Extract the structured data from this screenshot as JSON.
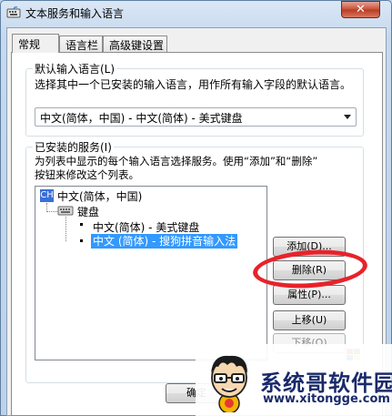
{
  "window": {
    "title": "文本服务和输入语言",
    "close_symbol": "✕"
  },
  "tabs": [
    {
      "label": "常规",
      "active": true
    },
    {
      "label": "语言栏",
      "active": false
    },
    {
      "label": "高级键设置",
      "active": false
    }
  ],
  "default_language": {
    "group_title": "默认输入语言(L)",
    "description": "选择其中一个已安装的输入语言，用作所有输入字段的默认语言。",
    "selected": "中文(简体，中国) - 中文(简体) - 美式键盘"
  },
  "installed_services": {
    "group_title": "已安装的服务(I)",
    "description_line1": "为列表中显示的每个输入语言选择服务。使用“添加”和“删除”",
    "description_line2": "按钮来修改这个列表。",
    "tree": {
      "language_badge": "CH",
      "language": "中文(简体，中国)",
      "category": "键盘",
      "items": [
        {
          "label": "中文(简体) - 美式键盘",
          "selected": false
        },
        {
          "label": "中文 (简体) - 搜狗拼音输入法",
          "selected": true
        }
      ]
    }
  },
  "buttons": {
    "add": "添加(D)...",
    "remove": "删除(R)",
    "properties": "属性(P)...",
    "move_up": "上移(U)",
    "move_down": "下移(O)",
    "ok": "确定"
  },
  "watermark": {
    "brand": "系统哥软件园",
    "url": "www.xitongge.com"
  }
}
